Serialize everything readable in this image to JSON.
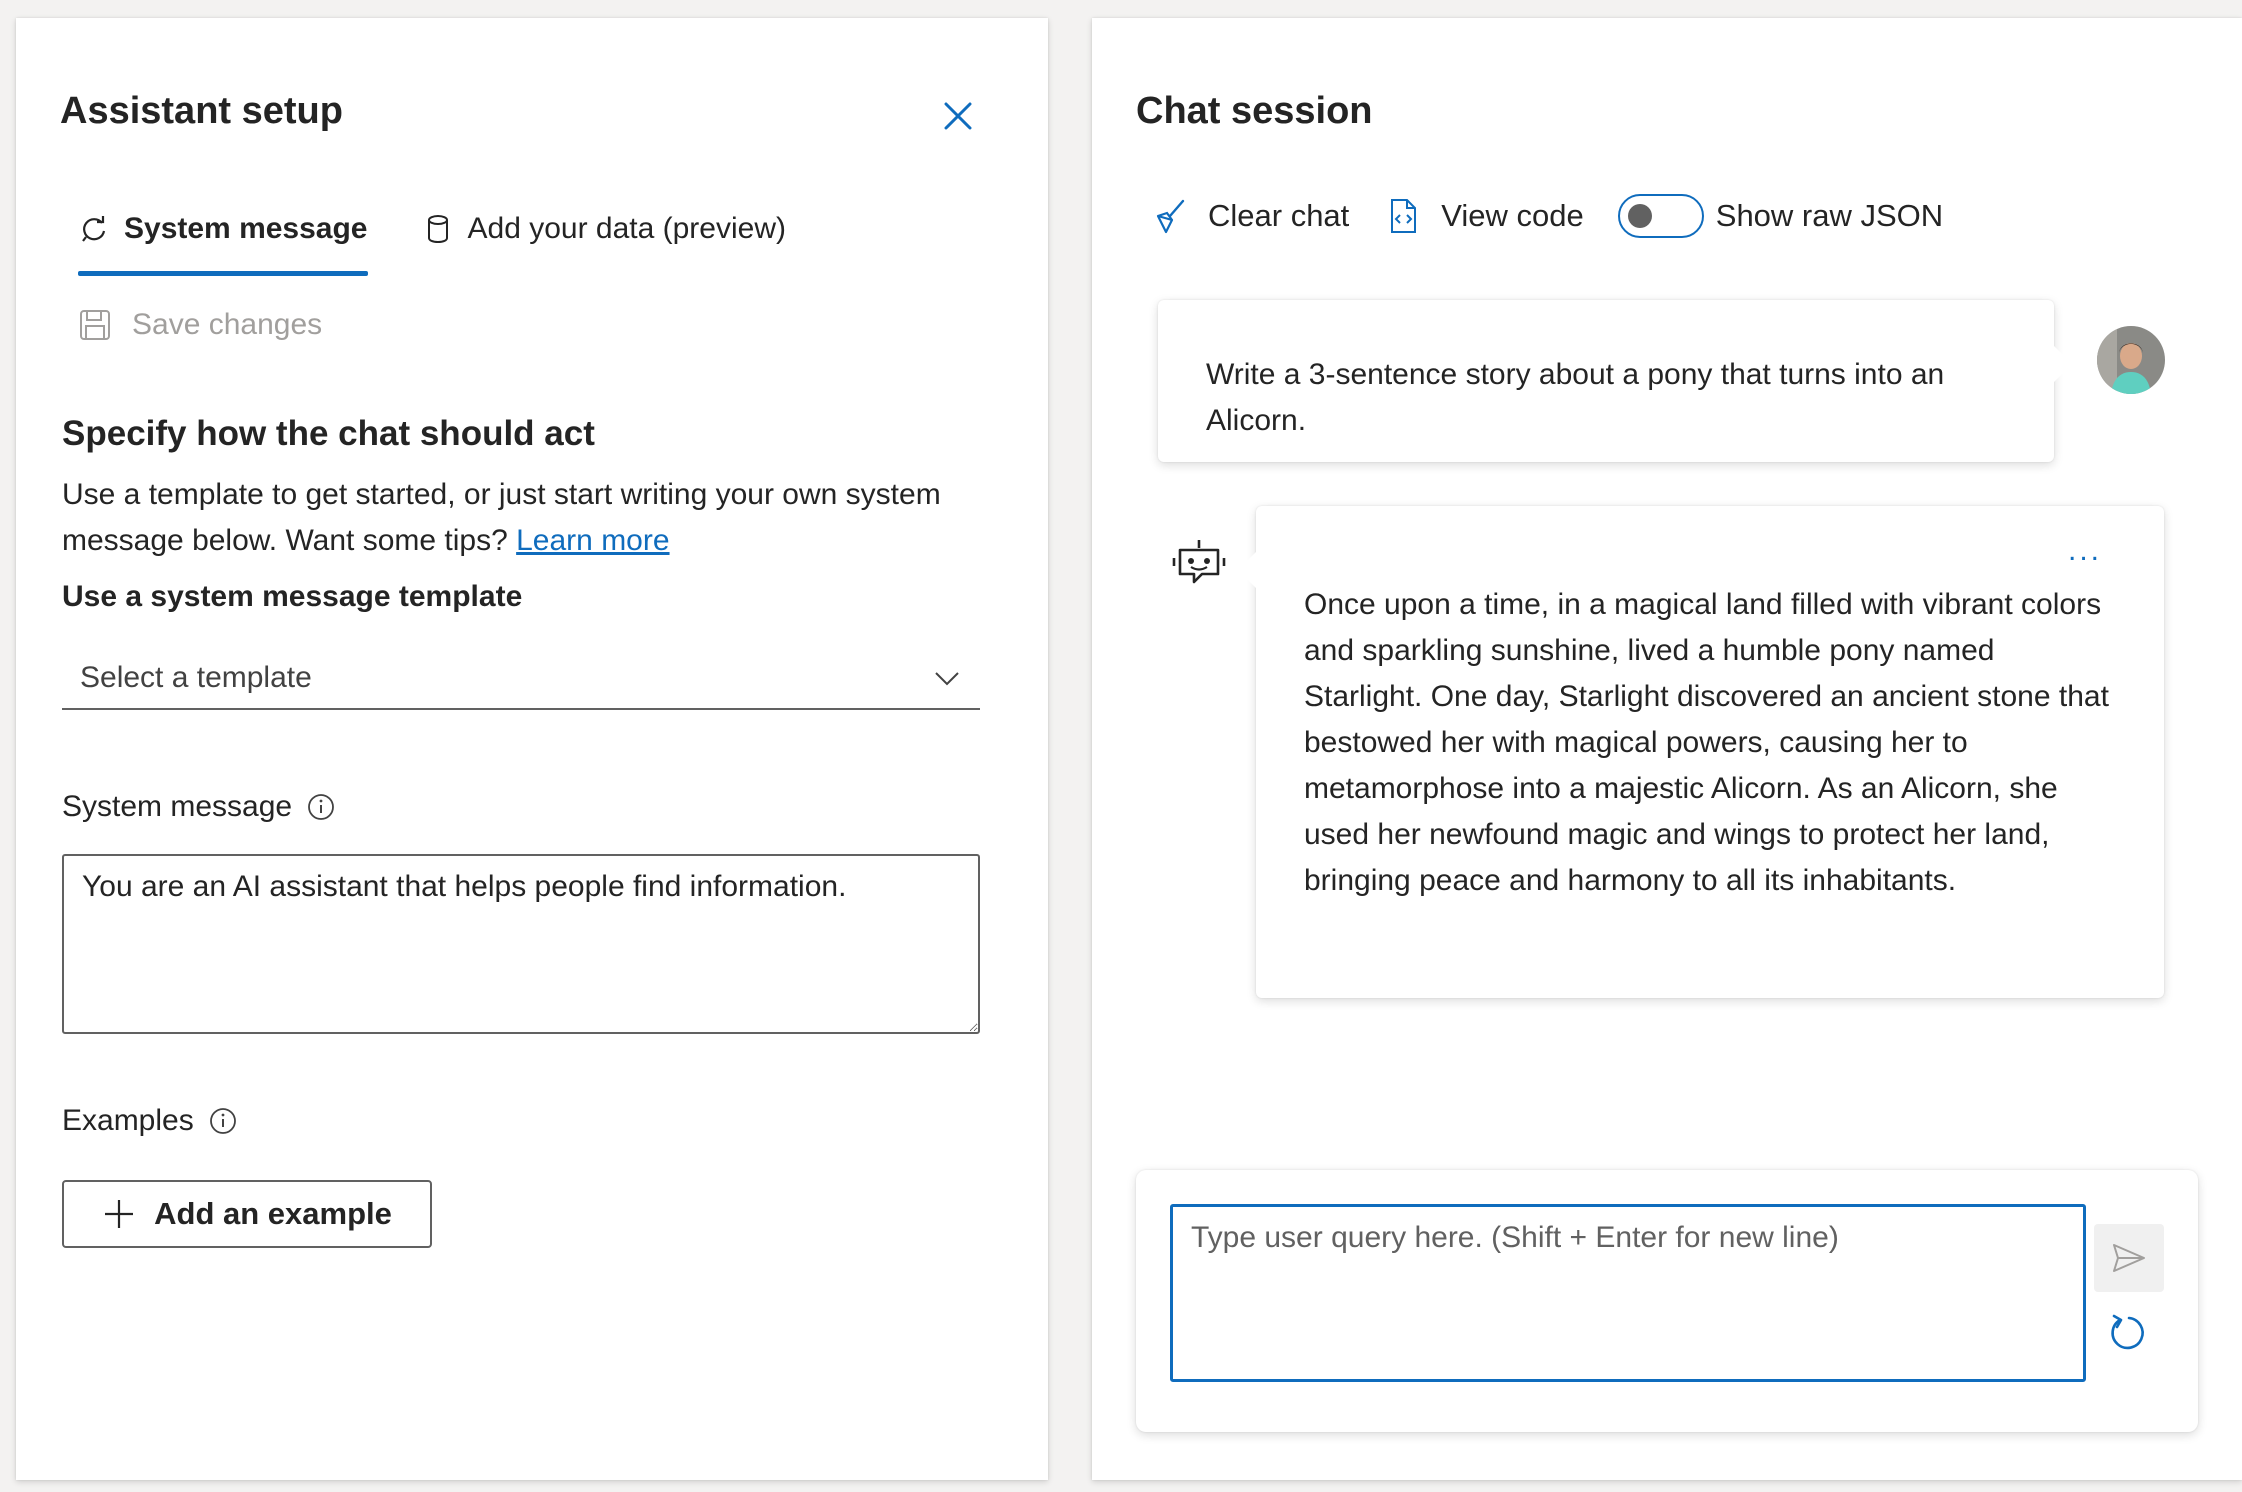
{
  "setup": {
    "title": "Assistant setup",
    "tabs": [
      {
        "label": "System message"
      },
      {
        "label": "Add your data (preview)"
      }
    ],
    "save_label": "Save changes",
    "heading": "Specify how the chat should act",
    "description": "Use a template to get started, or just start writing your own system message below. Want some tips?",
    "learn_more": "Learn more",
    "template_label": "Use a system message template",
    "template_placeholder": "Select a template",
    "system_message_label": "System message",
    "system_message_value": "You are an AI assistant that helps people find information.",
    "examples_label": "Examples",
    "add_example_label": "Add an example"
  },
  "chat": {
    "title": "Chat session",
    "toolbar": {
      "clear_label": "Clear chat",
      "view_code_label": "View code",
      "raw_json_label": "Show raw JSON"
    },
    "messages": [
      {
        "role": "user",
        "text": "Write a 3-sentence story about a pony that turns into an Alicorn."
      },
      {
        "role": "assistant",
        "text": "Once upon a time, in a magical land filled with vibrant colors and sparkling sunshine, lived a humble pony named Starlight. One day, Starlight discovered an ancient stone that bestowed her with magical powers, causing her to metamorphose into a majestic Alicorn. As an Alicorn, she used her newfound magic and wings to protect her land, bringing peace and harmony to all its inhabitants."
      }
    ],
    "more_label": "...",
    "input_placeholder": "Type user query here. (Shift + Enter for new line)"
  },
  "colors": {
    "accent": "#0f6cbd",
    "text": "#242424",
    "disabled": "#a19f9d"
  }
}
